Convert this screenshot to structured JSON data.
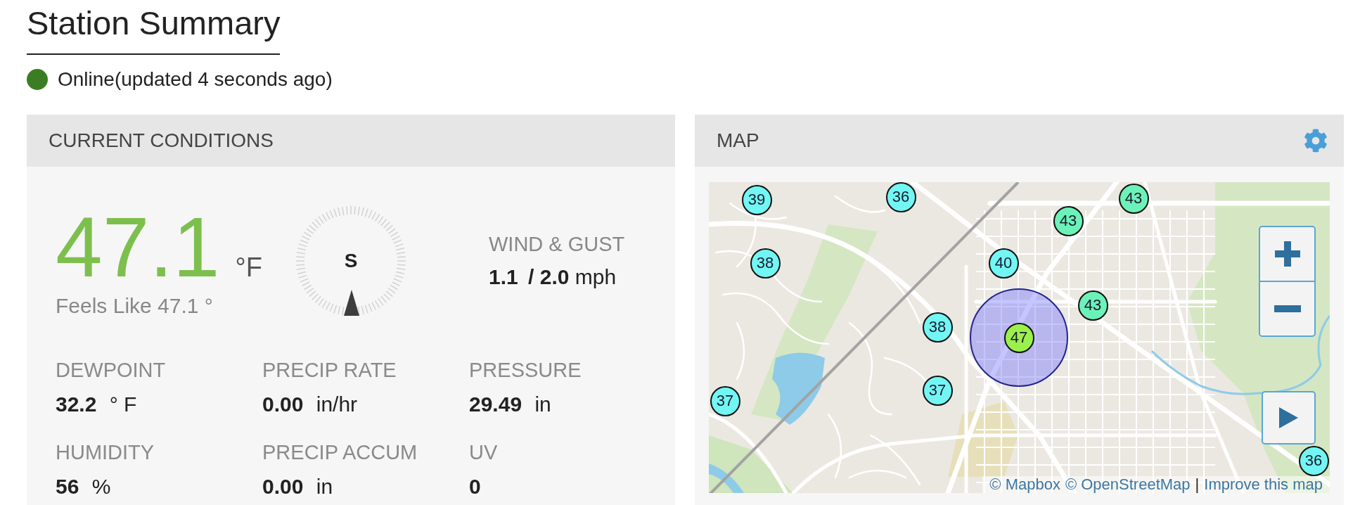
{
  "title": "Station Summary",
  "status": {
    "online": true,
    "text": "Online(updated 4 seconds ago)"
  },
  "current_conditions": {
    "title": "CURRENT CONDITIONS",
    "temperature": {
      "value": "47.1",
      "unit": "°F",
      "feels_like": "Feels Like 47.1 °"
    },
    "compass": {
      "direction": "S"
    },
    "wind": {
      "label": "WIND & GUST",
      "speed": "1.1",
      "gust": "/ 2.0",
      "unit": "mph"
    },
    "metrics": [
      {
        "label": "DEWPOINT",
        "value": "32.2",
        "unit": "° F"
      },
      {
        "label": "PRECIP RATE",
        "value": "0.00",
        "unit": "in/hr"
      },
      {
        "label": "PRESSURE",
        "value": "29.49",
        "unit": "in"
      },
      {
        "label": "HUMIDITY",
        "value": "56",
        "unit": "%"
      },
      {
        "label": "PRECIP ACCUM",
        "value": "0.00",
        "unit": "in"
      },
      {
        "label": "UV",
        "value": "0"
      }
    ]
  },
  "map": {
    "title": "MAP",
    "markers": [
      {
        "text": "39",
        "color": "#72f6f4",
        "selected": false
      },
      {
        "text": "36",
        "color": "#72f6f4",
        "selected": false
      },
      {
        "text": "43",
        "color": "#6cf2b8",
        "selected": false
      },
      {
        "text": "43",
        "color": "#6cf2b8",
        "selected": false
      },
      {
        "text": "38",
        "color": "#72f6f4",
        "selected": false
      },
      {
        "text": "40",
        "color": "#72f6f4",
        "selected": false
      },
      {
        "text": "43",
        "color": "#6cf2b8",
        "selected": false
      },
      {
        "text": "38",
        "color": "#72f6f4",
        "selected": false
      },
      {
        "text": "47",
        "color": "#9cf04b",
        "selected": true
      },
      {
        "text": "37",
        "color": "#72f6f4",
        "selected": false
      },
      {
        "text": "37",
        "color": "#72f6f4",
        "selected": false
      },
      {
        "text": "36",
        "color": "#72f6f4",
        "selected": false
      }
    ],
    "attribution": [
      {
        "kind": "link",
        "text": "© Mapbox"
      },
      {
        "kind": "link",
        "text": "© OpenStreetMap"
      },
      {
        "kind": "separator",
        "text": "|"
      },
      {
        "kind": "link",
        "text": "Improve this map"
      }
    ]
  }
}
